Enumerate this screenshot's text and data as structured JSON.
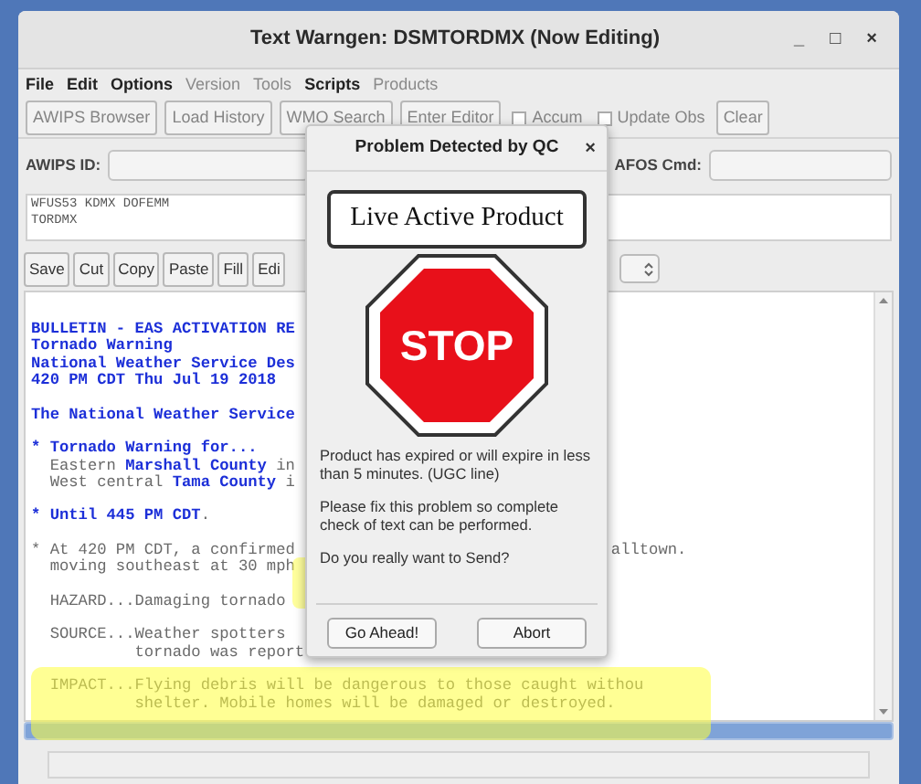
{
  "window": {
    "title": "Text Warngen: DSMTORDMX (Now Editing)",
    "controls": [
      "_",
      "□",
      "×"
    ]
  },
  "menu": [
    {
      "label": "File",
      "disabled": false
    },
    {
      "label": "Edit",
      "disabled": false
    },
    {
      "label": "Options",
      "disabled": false
    },
    {
      "label": "Version",
      "disabled": true
    },
    {
      "label": "Tools",
      "disabled": true
    },
    {
      "label": "Scripts",
      "disabled": false
    },
    {
      "label": "Products",
      "disabled": true
    }
  ],
  "toolbar": [
    {
      "kind": "button",
      "label": "AWIPS Browser",
      "disabled": true
    },
    {
      "kind": "button",
      "label": "Load History",
      "disabled": true
    },
    {
      "kind": "button",
      "label": "WMO Search",
      "disabled": true
    },
    {
      "kind": "button",
      "label": "Enter Editor",
      "disabled": true
    },
    {
      "kind": "checkbox",
      "label": "Accum",
      "checked": false,
      "disabled": true
    },
    {
      "kind": "checkbox",
      "label": "Update Obs",
      "checked": false,
      "disabled": true
    },
    {
      "kind": "button",
      "label": "Clear",
      "disabled": true
    }
  ],
  "awips_id": {
    "label": "AWIPS ID:"
  },
  "afos_cmd": {
    "label": "AFOS Cmd:"
  },
  "header_text": [
    "WFUS53 KDMX DOFEMM",
    "TORDMX"
  ],
  "edit_buttons": [
    "Save",
    "Cut",
    "Copy",
    "Paste",
    "Fill",
    "Edi"
  ],
  "product_lines": [
    {
      "kind": "text",
      "segments": [
        {
          "text": "BULLETIN - EAS ACTIVATION RE",
          "blue": true
        }
      ]
    },
    {
      "kind": "text",
      "segments": [
        {
          "text": "Tornado Warning",
          "blue": true
        }
      ]
    },
    {
      "kind": "text",
      "segments": [
        {
          "text": "National Weather Service Des",
          "blue": true
        }
      ]
    },
    {
      "kind": "text",
      "segments": [
        {
          "text": "420 PM CDT Thu Jul 19 2018",
          "blue": true
        }
      ]
    },
    {
      "kind": "blank"
    },
    {
      "kind": "text",
      "segments": [
        {
          "text": "The National Weather Service",
          "blue": true
        }
      ]
    },
    {
      "kind": "blank"
    },
    {
      "kind": "text",
      "segments": [
        {
          "text": "* Tornado Warning for...",
          "blue": true
        }
      ]
    },
    {
      "kind": "text",
      "segments": [
        {
          "text": "  Eastern ",
          "blue": false
        },
        {
          "text": "Marshall County",
          "blue": true
        },
        {
          "text": " in",
          "blue": false
        }
      ]
    },
    {
      "kind": "text",
      "segments": [
        {
          "text": "  West central ",
          "blue": false
        },
        {
          "text": "Tama County",
          "blue": true
        },
        {
          "text": " i",
          "blue": false
        }
      ]
    },
    {
      "kind": "blank"
    },
    {
      "kind": "text",
      "segments": [
        {
          "text": "* Until 445 PM CDT",
          "blue": true
        },
        {
          "text": ".",
          "blue": false
        }
      ]
    },
    {
      "kind": "blank"
    },
    {
      "kind": "text",
      "segments": [
        {
          "text": "* At 420 PM CDT, a confirmed",
          "blue": false
        }
      ],
      "right": "alltown."
    },
    {
      "kind": "text",
      "segments": [
        {
          "text": "  moving southeast at 30 mph",
          "blue": false
        }
      ]
    },
    {
      "kind": "blank"
    },
    {
      "kind": "text",
      "segments": [
        {
          "text": "  HAZARD...Damaging tornado",
          "blue": false
        }
      ]
    },
    {
      "kind": "blank"
    },
    {
      "kind": "text",
      "segments": [
        {
          "text": "  SOURCE...Weather spotters",
          "blue": false
        }
      ]
    },
    {
      "kind": "text",
      "segments": [
        {
          "text": "           tornado was report",
          "blue": false
        }
      ]
    },
    {
      "kind": "blank"
    },
    {
      "kind": "text",
      "segments": [
        {
          "text": "  IMPACT...Flying debris will be dangerous to those caught withou",
          "blue": false
        }
      ]
    },
    {
      "kind": "text",
      "segments": [
        {
          "text": "           shelter. Mobile homes will be damaged or destroyed.",
          "blue": false
        }
      ]
    }
  ],
  "dialog": {
    "title": "Problem Detected by QC",
    "close": "×",
    "banner": "Live Active Product",
    "sign": "STOP",
    "messages": [
      "Product has expired or will expire in less than 5 minutes. (UGC line)",
      "Please fix this problem so complete check of text can be performed.",
      "Do you really want to Send?"
    ],
    "buttons": [
      "Go Ahead!",
      "Abort"
    ]
  }
}
